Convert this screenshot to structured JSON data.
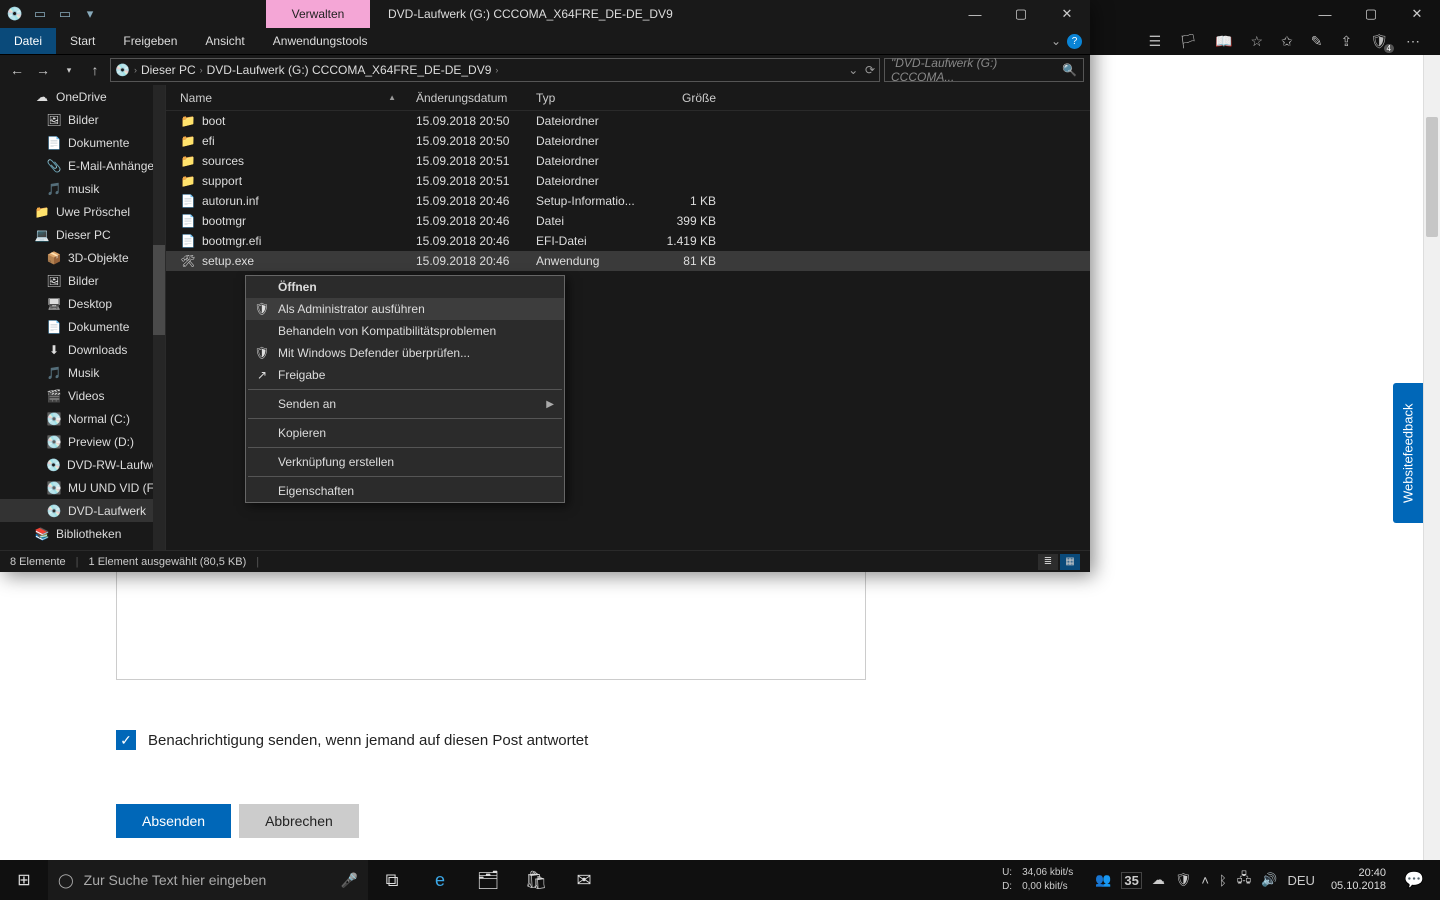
{
  "browser": {
    "win_controls": {
      "min": "—",
      "max": "▢",
      "close": "✕"
    },
    "ext_badge": "4"
  },
  "page": {
    "feedback_label": "Websitefeedback",
    "notify_text": "Benachrichtigung senden, wenn jemand auf diesen Post antwortet",
    "submit": "Absenden",
    "cancel": "Abbrechen"
  },
  "explorer": {
    "manage_tab": "Verwalten",
    "title": "DVD-Laufwerk (G:) CCCOMA_X64FRE_DE-DE_DV9",
    "ribbon": {
      "file": "Datei",
      "tabs": [
        "Start",
        "Freigeben",
        "Ansicht",
        "Anwendungstools"
      ]
    },
    "breadcrumb": [
      "Dieser PC",
      "DVD-Laufwerk (G:) CCCOMA_X64FRE_DE-DE_DV9"
    ],
    "search_placeholder": "\"DVD-Laufwerk (G:) CCCOMA...",
    "columns": {
      "name": "Name",
      "date": "Änderungsdatum",
      "type": "Typ",
      "size": "Größe"
    },
    "tree": [
      {
        "label": "OneDrive",
        "icon": "☁",
        "l": 1
      },
      {
        "label": "Bilder",
        "icon": "🖼",
        "l": 2
      },
      {
        "label": "Dokumente",
        "icon": "📄",
        "l": 2
      },
      {
        "label": "E-Mail-Anhänge",
        "icon": "📎",
        "l": 2
      },
      {
        "label": "musik",
        "icon": "🎵",
        "l": 2
      },
      {
        "label": "Uwe Pröschel",
        "icon": "📁",
        "l": 1
      },
      {
        "label": "Dieser PC",
        "icon": "💻",
        "l": 1
      },
      {
        "label": "3D-Objekte",
        "icon": "📦",
        "l": 2
      },
      {
        "label": "Bilder",
        "icon": "🖼",
        "l": 2
      },
      {
        "label": "Desktop",
        "icon": "🖥",
        "l": 2
      },
      {
        "label": "Dokumente",
        "icon": "📄",
        "l": 2
      },
      {
        "label": "Downloads",
        "icon": "⬇",
        "l": 2
      },
      {
        "label": "Musik",
        "icon": "🎵",
        "l": 2
      },
      {
        "label": "Videos",
        "icon": "🎬",
        "l": 2
      },
      {
        "label": "Normal (C:)",
        "icon": "💽",
        "l": 2
      },
      {
        "label": "Preview (D:)",
        "icon": "💽",
        "l": 2
      },
      {
        "label": "DVD-RW-Laufwerk",
        "icon": "💿",
        "l": 2
      },
      {
        "label": "MU UND VID (F:)",
        "icon": "💽",
        "l": 2
      },
      {
        "label": "DVD-Laufwerk",
        "icon": "💿",
        "l": 2,
        "sel": true
      },
      {
        "label": "Bibliotheken",
        "icon": "📚",
        "l": 1
      }
    ],
    "files": [
      {
        "name": "boot",
        "date": "15.09.2018 20:50",
        "type": "Dateiordner",
        "size": "",
        "icon": "📁"
      },
      {
        "name": "efi",
        "date": "15.09.2018 20:50",
        "type": "Dateiordner",
        "size": "",
        "icon": "📁"
      },
      {
        "name": "sources",
        "date": "15.09.2018 20:51",
        "type": "Dateiordner",
        "size": "",
        "icon": "📁"
      },
      {
        "name": "support",
        "date": "15.09.2018 20:51",
        "type": "Dateiordner",
        "size": "",
        "icon": "📁"
      },
      {
        "name": "autorun.inf",
        "date": "15.09.2018 20:46",
        "type": "Setup-Informatio...",
        "size": "1 KB",
        "icon": "📄"
      },
      {
        "name": "bootmgr",
        "date": "15.09.2018 20:46",
        "type": "Datei",
        "size": "399 KB",
        "icon": "📄"
      },
      {
        "name": "bootmgr.efi",
        "date": "15.09.2018 20:46",
        "type": "EFI-Datei",
        "size": "1.419 KB",
        "icon": "📄"
      },
      {
        "name": "setup.exe",
        "date": "15.09.2018 20:46",
        "type": "Anwendung",
        "size": "81 KB",
        "icon": "🛠",
        "sel": true
      }
    ],
    "status": {
      "items": "8 Elemente",
      "selected": "1 Element ausgewählt (80,5 KB)"
    },
    "context_menu": [
      {
        "label": "Öffnen",
        "bold": true
      },
      {
        "label": "Als Administrator ausführen",
        "icon": "🛡",
        "hl": true
      },
      {
        "label": "Behandeln von Kompatibilitätsproblemen"
      },
      {
        "label": "Mit Windows Defender überprüfen...",
        "icon": "🛡"
      },
      {
        "label": "Freigabe",
        "icon": "↗"
      },
      {
        "sep": true
      },
      {
        "label": "Senden an",
        "arrow": true
      },
      {
        "sep": true
      },
      {
        "label": "Kopieren"
      },
      {
        "sep": true
      },
      {
        "label": "Verknüpfung erstellen"
      },
      {
        "sep": true
      },
      {
        "label": "Eigenschaften"
      }
    ]
  },
  "taskbar": {
    "search_placeholder": "Zur Suche Text hier eingeben",
    "net": {
      "u_label": "U:",
      "u_val": "34,06 kbit/s",
      "d_label": "D:",
      "d_val": "0,00 kbit/s"
    },
    "gpu": "35",
    "lang": "DEU",
    "time": "20:40",
    "date": "05.10.2018"
  }
}
